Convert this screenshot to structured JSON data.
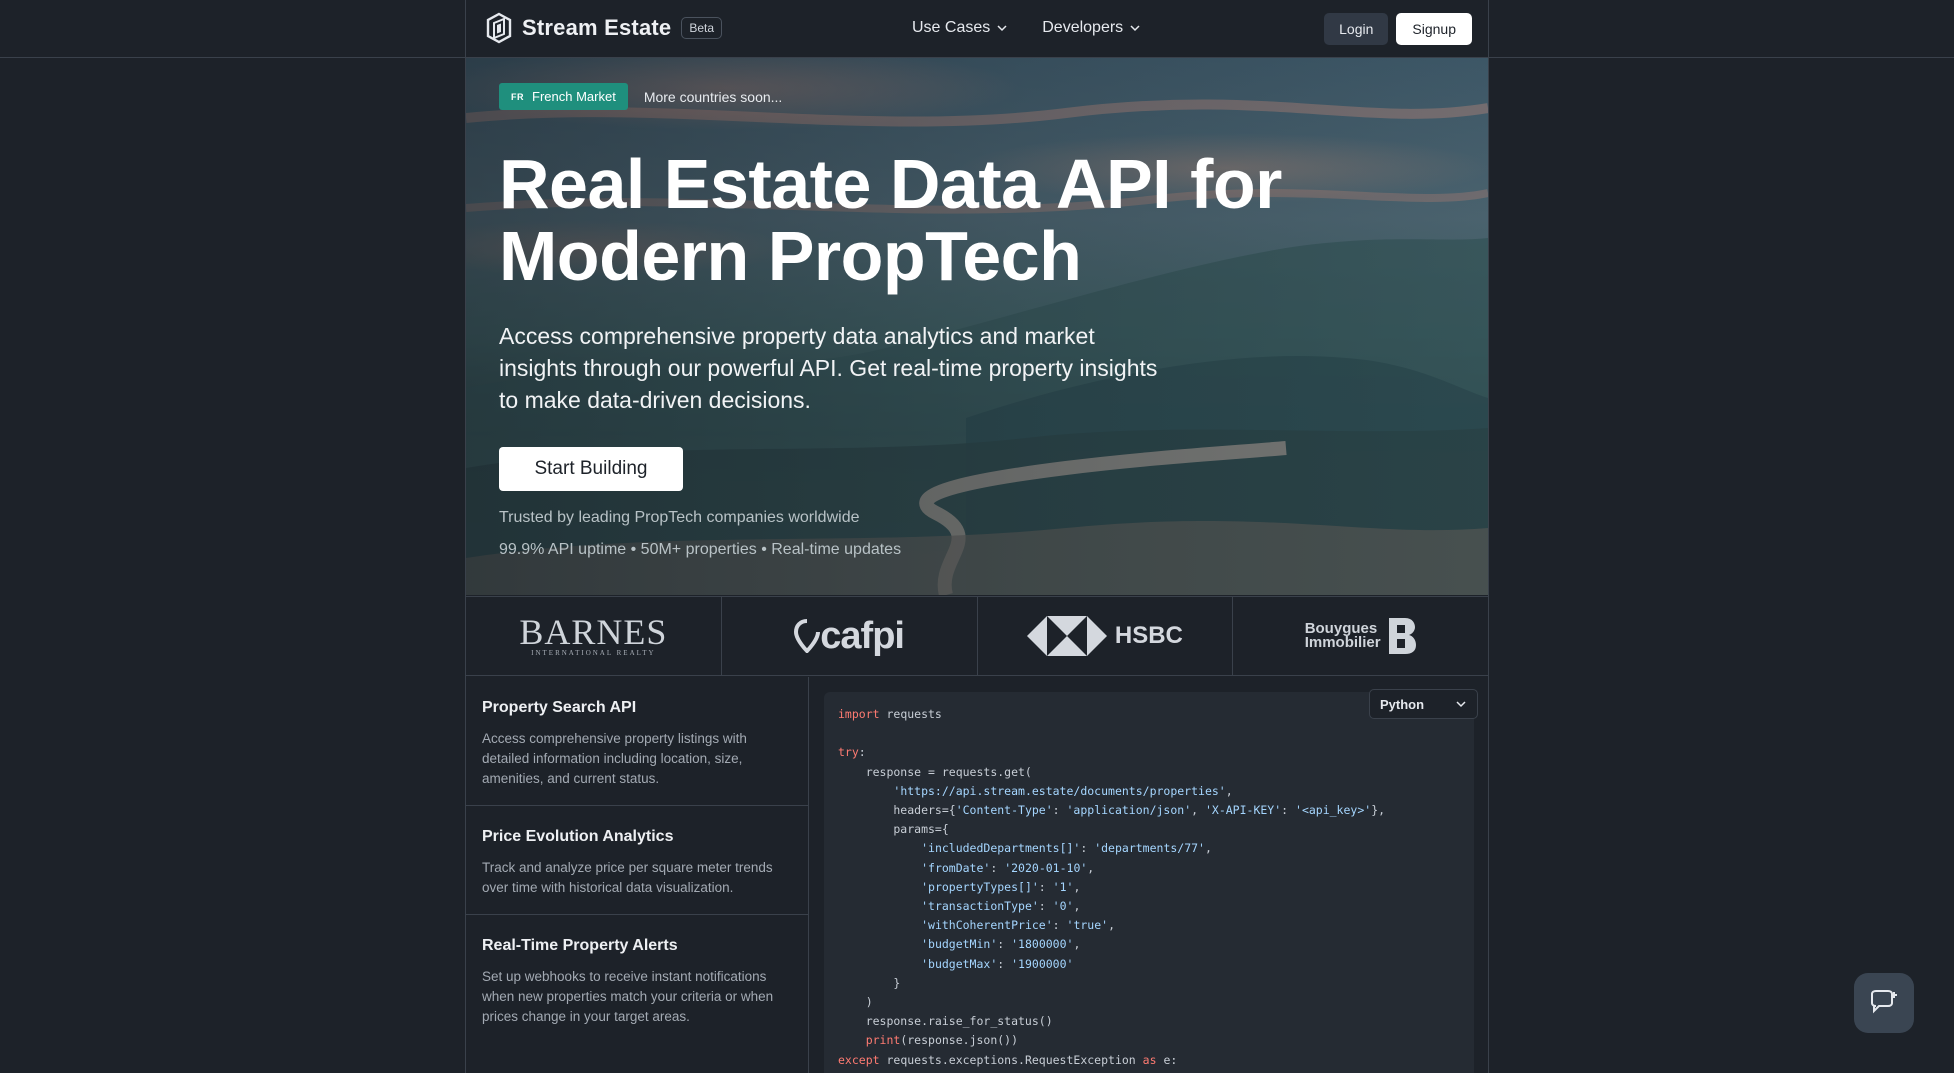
{
  "header": {
    "brand": "Stream Estate",
    "badge": "Beta",
    "nav": [
      "Use Cases",
      "Developers"
    ],
    "login": "Login",
    "signup": "Signup"
  },
  "hero": {
    "market_code": "FR",
    "market_label": "French Market",
    "more": "More countries soon...",
    "title_line1": "Real Estate Data API for",
    "title_line2": "Modern PropTech",
    "subtitle": "Access comprehensive property data analytics and market insights through our powerful API. Get real-time property insights to make data-driven decisions.",
    "cta": "Start Building",
    "trusted": "Trusted by leading PropTech companies worldwide",
    "stats": "99.9% API uptime • 50M+ properties • Real-time updates"
  },
  "logos": {
    "barnes": "BARNES",
    "barnes_sub": "INTERNATIONAL REALTY",
    "cafpi": "cafpi",
    "hsbc": "HSBC",
    "bouygues_l1": "Bouygues",
    "bouygues_l2": "Immobilier"
  },
  "features": [
    {
      "title": "Property Search API",
      "desc": "Access comprehensive property listings with detailed information including location, size, amenities, and current status."
    },
    {
      "title": "Price Evolution Analytics",
      "desc": "Track and analyze price per square meter trends over time with historical data visualization."
    },
    {
      "title": "Real-Time Property Alerts",
      "desc": "Set up webhooks to receive instant notifications when new properties match your criteria or when prices change in your target areas."
    }
  ],
  "code": {
    "language": "Python",
    "l_import_kw": "import",
    "l_import_mod": " requests",
    "l_try": "try",
    "l_response": "    response = requests.get(",
    "l_url": "'https://api.stream.estate/documents/properties'",
    "l_headers_a": "        headers={",
    "l_h_k1": "'Content-Type'",
    "l_h_v1": "'application/json'",
    "l_h_k2": "'X-API-KEY'",
    "l_h_v2": "'<api_key>'",
    "l_params": "        params={",
    "p1k": "'includedDepartments[]'",
    "p1v": "'departments/77'",
    "p2k": "'fromDate'",
    "p2v": "'2020-01-10'",
    "p3k": "'propertyTypes[]'",
    "p3v": "'1'",
    "p4k": "'transactionType'",
    "p4v": "'0'",
    "p5k": "'withCoherentPrice'",
    "p5v": "'true'",
    "p6k": "'budgetMin'",
    "p6v": "'1800000'",
    "p7k": "'budgetMax'",
    "p7v": "'1900000'",
    "l_close_brace": "        }",
    "l_close_paren": "    )",
    "l_raise": "    response.raise_for_status()",
    "l_print_fn": "print",
    "l_print_rest": "(response.json())",
    "l_except_kw": "except",
    "l_except_mid": " requests.exceptions.RequestException ",
    "l_as": "as",
    "l_e": " e:"
  }
}
